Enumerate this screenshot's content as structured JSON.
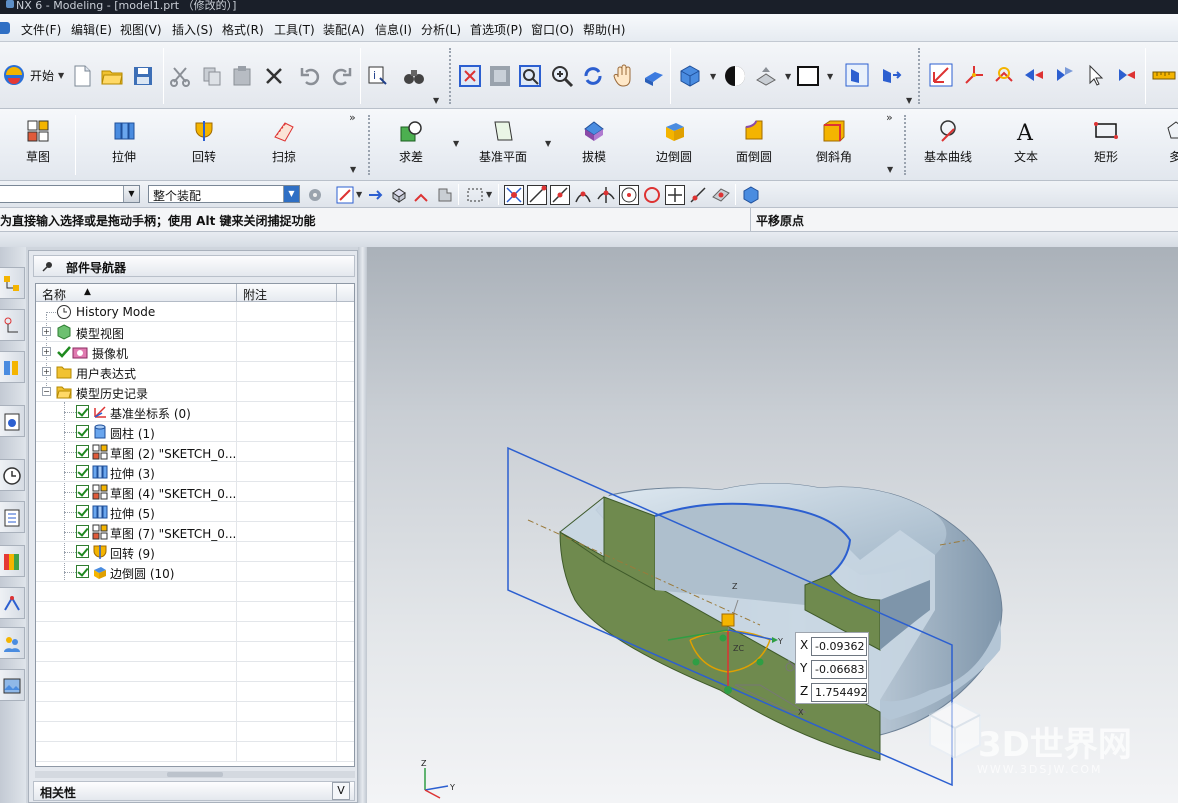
{
  "window": {
    "title": "NX 6 - Modeling - [model1.prt （修改的）]"
  },
  "menu": [
    "文件(F)",
    "编辑(E)",
    "视图(V)",
    "插入(S)",
    "格式(R)",
    "工具(T)",
    "装配(A)",
    "信息(I)",
    "分析(L)",
    "首选项(P)",
    "窗口(O)",
    "帮助(H)"
  ],
  "toolbar_standard": {
    "start_label": "开始"
  },
  "toolbar_features": {
    "buttons": [
      "草图",
      "拉伸",
      "回转",
      "扫掠",
      "求差",
      "基准平面",
      "拔模",
      "边倒圆",
      "面倒圆",
      "倒斜角",
      "基本曲线",
      "文本",
      "矩形",
      "多"
    ]
  },
  "selection_bar": {
    "filter_value": "",
    "scope_value": "整个装配"
  },
  "status": {
    "prompt": "为直接输入选择或是拖动手柄；使用 Alt 键来关闭捕捉功能",
    "right": "平移原点"
  },
  "navigator": {
    "title": "部件导航器",
    "col_name": "名称",
    "col_note": "附注",
    "rows": [
      {
        "label": "History Mode"
      },
      {
        "label": "模型视图"
      },
      {
        "label": "摄像机"
      },
      {
        "label": "用户表达式"
      },
      {
        "label": "模型历史记录"
      },
      {
        "label": "基准坐标系 (0)"
      },
      {
        "label": "圆柱 (1)"
      },
      {
        "label": "草图 (2) \"SKETCH_0..."
      },
      {
        "label": "拉伸 (3)"
      },
      {
        "label": "草图 (4) \"SKETCH_0..."
      },
      {
        "label": "拉伸 (5)"
      },
      {
        "label": "草图 (7) \"SKETCH_0..."
      },
      {
        "label": "回转 (9)"
      },
      {
        "label": "边倒圆 (10)"
      }
    ],
    "relations_title": "相关性"
  },
  "coord_input": {
    "x_label": "X",
    "x_value": "-0.09362",
    "y_label": "Y",
    "y_value": "-0.06683",
    "z_label": "Z",
    "z_value": "1.754492"
  },
  "triad": {
    "z": "Z",
    "y": "Y",
    "x": "X",
    "zc": "ZC"
  },
  "watermark": {
    "text": "3D世界网",
    "url": "WWW.3DSJW.COM"
  },
  "colors": {
    "face_green": "#6f8a4e",
    "body_blue": "#b9cfe0",
    "plane_blue": "#2c5fd0",
    "accent": "#ffb000"
  }
}
